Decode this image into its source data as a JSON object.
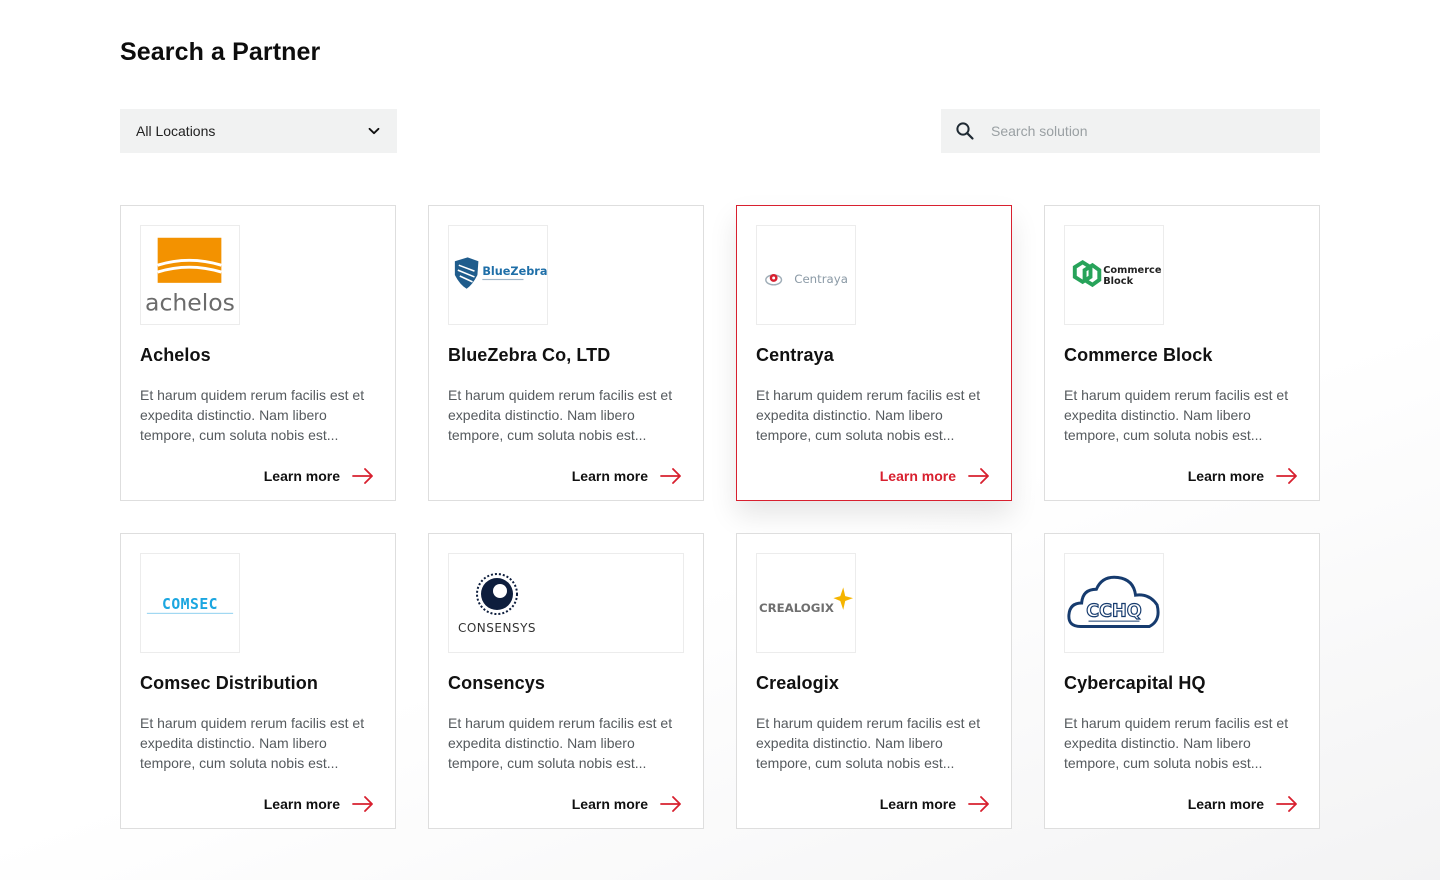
{
  "page": {
    "title": "Search a Partner"
  },
  "filters": {
    "location": {
      "selected": "All Locations"
    },
    "search": {
      "placeholder": "Search solution",
      "value": ""
    }
  },
  "colors": {
    "accent": "#d8202f",
    "field_bg": "#f1f2f2"
  },
  "partners": [
    {
      "name": "Achelos",
      "logo_text": "achelos",
      "logo_icon": "achelos-logo",
      "description": "Et harum quidem rerum facilis est et expedita distinctio. Nam libero tempore, cum soluta nobis est...",
      "link": "Learn more",
      "active": false
    },
    {
      "name": "BlueZebra Co, LTD",
      "logo_text": "BlueZebra",
      "logo_icon": "bluezebra-logo",
      "description": "Et harum quidem rerum facilis est et expedita distinctio. Nam libero tempore, cum soluta nobis est...",
      "link": "Learn more",
      "active": false
    },
    {
      "name": "Centraya",
      "logo_text": "Centraya",
      "logo_icon": "centraya-logo",
      "description": "Et harum quidem rerum facilis est et expedita distinctio. Nam libero tempore, cum soluta nobis est...",
      "link": "Learn more",
      "active": true
    },
    {
      "name": "Commerce Block",
      "logo_text": "Commerce Block",
      "logo_icon": "commerce-block-logo",
      "description": "Et harum quidem rerum facilis est et expedita distinctio. Nam libero tempore, cum soluta nobis est...",
      "link": "Learn more",
      "active": false
    },
    {
      "name": "Comsec Distribution",
      "logo_text": "COMSEC",
      "logo_icon": "comsec-logo",
      "description": "Et harum quidem rerum facilis est et expedita distinctio. Nam libero tempore, cum soluta nobis est...",
      "link": "Learn more",
      "active": false
    },
    {
      "name": "Consencys",
      "logo_text": "CONSENSYS",
      "logo_icon": "consensys-logo",
      "description": "Et harum quidem rerum facilis est et expedita distinctio. Nam libero tempore, cum soluta nobis est...",
      "link": "Learn more",
      "active": false
    },
    {
      "name": "Crealogix",
      "logo_text": "CREALOGIX",
      "logo_icon": "crealogix-logo",
      "description": "Et harum quidem rerum facilis est et expedita distinctio. Nam libero tempore, cum soluta nobis est...",
      "link": "Learn more",
      "active": false
    },
    {
      "name": "Cybercapital HQ",
      "logo_text": "CCHQ",
      "logo_icon": "cchq-logo",
      "description": "Et harum quidem rerum facilis est et expedita distinctio. Nam libero tempore, cum soluta nobis est...",
      "link": "Learn more",
      "active": false
    }
  ]
}
